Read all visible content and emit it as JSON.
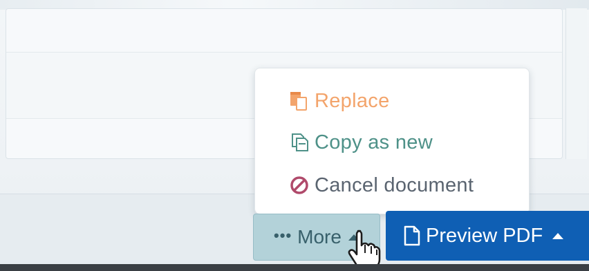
{
  "menu": {
    "items": [
      {
        "label": "Replace",
        "icon": "replace-icon",
        "color": "#f3a46b"
      },
      {
        "label": "Copy as new",
        "icon": "copy-icon",
        "color": "#4e9188"
      },
      {
        "label": "Cancel document",
        "icon": "cancel-icon",
        "color": "#b04a6b"
      }
    ]
  },
  "toolbar": {
    "more_label": "More",
    "more_icon": "ellipsis-icon",
    "preview_label": "Preview PDF",
    "preview_icon": "document-icon"
  },
  "colors": {
    "primary": "#0f5fb4",
    "more_button_bg": "#b3d2d9",
    "replace": "#f3a46b",
    "copy": "#4e9188",
    "cancel_icon": "#b04a6b"
  }
}
